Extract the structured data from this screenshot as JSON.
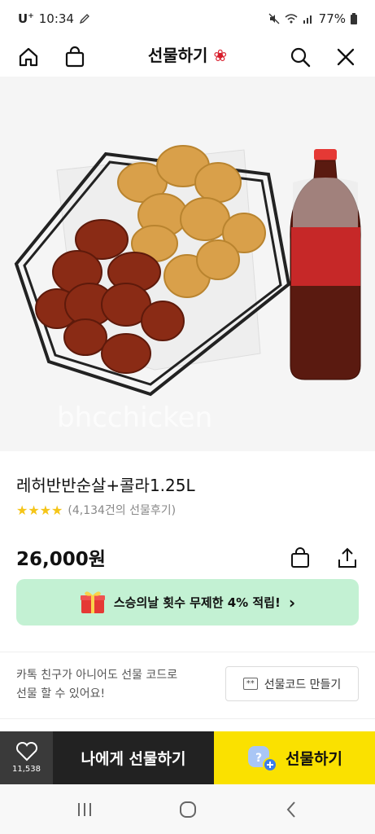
{
  "status_bar": {
    "carrier": "U",
    "carrier_sup": "+",
    "time": "10:34",
    "battery": "77%"
  },
  "header": {
    "title": "선물하기",
    "icons": [
      "home-icon",
      "shopping-bag-icon",
      "search-icon",
      "close-icon"
    ]
  },
  "hero": {
    "watermark": "bhcchicken"
  },
  "product": {
    "name": "레허반반순살+콜라1.25L",
    "stars": "★★★★",
    "reviews": "(4,134건의 선물후기)",
    "price": "26,000원"
  },
  "promo": {
    "text": "스승의날 횟수 무제한 4% 적립!",
    "chevron": "›"
  },
  "gift_code": {
    "line1": "카톡 친구가 아니어도 선물 코드로",
    "line2": "선물 할 수 있어요!",
    "badge": "**",
    "button_label": "선물코드 만들기"
  },
  "bottom": {
    "like_count": "11,538",
    "self_gift_label": "나에게 선물하기",
    "gift_label": "선물하기"
  },
  "colors": {
    "accent_yellow": "#fae100",
    "promo_green": "#c3f1d3",
    "star": "#f5c518",
    "dark": "#222222"
  }
}
